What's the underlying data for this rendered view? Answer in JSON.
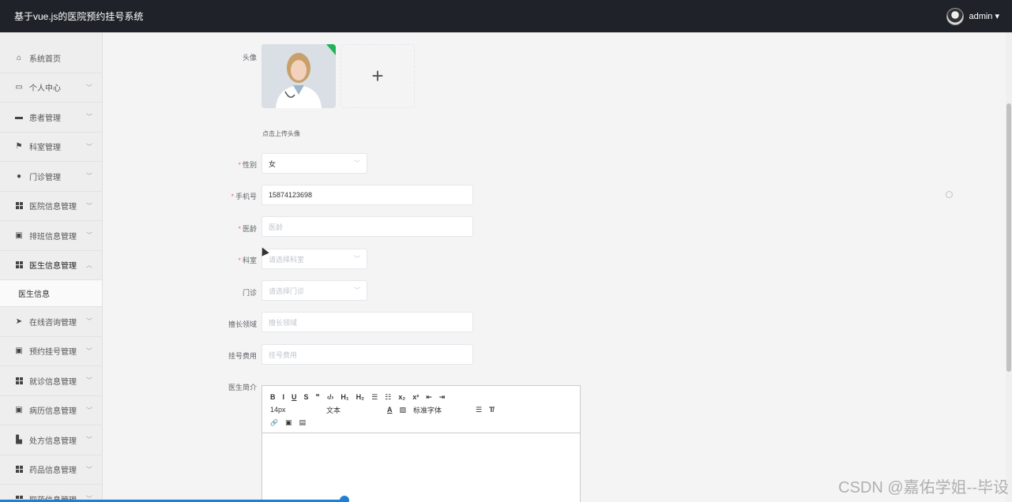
{
  "topbar": {
    "title": "基于vue.js的医院预约挂号系统",
    "user": "admin ▾"
  },
  "sidebar": {
    "items": [
      {
        "label": "系统首页",
        "icon": "home-icon",
        "arrow": ""
      },
      {
        "label": "个人中心",
        "icon": "calendar-icon",
        "arrow": "﹀"
      },
      {
        "label": "患者管理",
        "icon": "briefcase-icon",
        "arrow": "﹀"
      },
      {
        "label": "科室管理",
        "icon": "flag-icon",
        "arrow": "﹀"
      },
      {
        "label": "门诊管理",
        "icon": "user-icon",
        "arrow": "﹀"
      },
      {
        "label": "医院信息管理",
        "icon": "grid-icon",
        "arrow": "﹀"
      },
      {
        "label": "排班信息管理",
        "icon": "clipboard-icon",
        "arrow": "﹀"
      },
      {
        "label": "医生信息管理",
        "icon": "grid-icon",
        "arrow": "︿"
      }
    ],
    "sub": {
      "label": "医生信息"
    },
    "items2": [
      {
        "label": "在线咨询管理",
        "icon": "send-icon",
        "arrow": "﹀"
      },
      {
        "label": "预约挂号管理",
        "icon": "clipboard-icon",
        "arrow": "﹀"
      },
      {
        "label": "就诊信息管理",
        "icon": "grid-icon",
        "arrow": "﹀"
      },
      {
        "label": "病历信息管理",
        "icon": "clipboard-icon",
        "arrow": "﹀"
      },
      {
        "label": "处方信息管理",
        "icon": "thumb-icon",
        "arrow": "﹀"
      },
      {
        "label": "药品信息管理",
        "icon": "grid-icon",
        "arrow": "﹀"
      },
      {
        "label": "取药信息管理",
        "icon": "grid-icon",
        "arrow": "﹀"
      }
    ]
  },
  "form": {
    "avatar_label": "头像",
    "upload_hint": "点击上传头像",
    "gender_label": "性别",
    "gender_value": "女",
    "phone_label": "手机号",
    "phone_value": "15874123698",
    "age_label": "医龄",
    "age_placeholder": "医龄",
    "dept_label": "科室",
    "dept_placeholder": "请选择科室",
    "clinic_label": "门诊",
    "clinic_placeholder": "请选择门诊",
    "specialty_label": "擅长领域",
    "specialty_placeholder": "擅长领域",
    "fee_label": "挂号费用",
    "fee_placeholder": "挂号费用",
    "intro_label": "医生简介"
  },
  "editor": {
    "row1": [
      "B",
      "I",
      "U",
      "S",
      "❞",
      "‹/›",
      "H₁",
      "H₂",
      "☰",
      "☷",
      "x₂",
      "x²",
      "⇤",
      "⇥"
    ],
    "font_size": "14px",
    "text_style": "文本",
    "font_family": "标准字体",
    "row3": [
      "🔗",
      "▣",
      "▤"
    ]
  },
  "watermark": "CSDN @嘉佑学姐--毕设"
}
